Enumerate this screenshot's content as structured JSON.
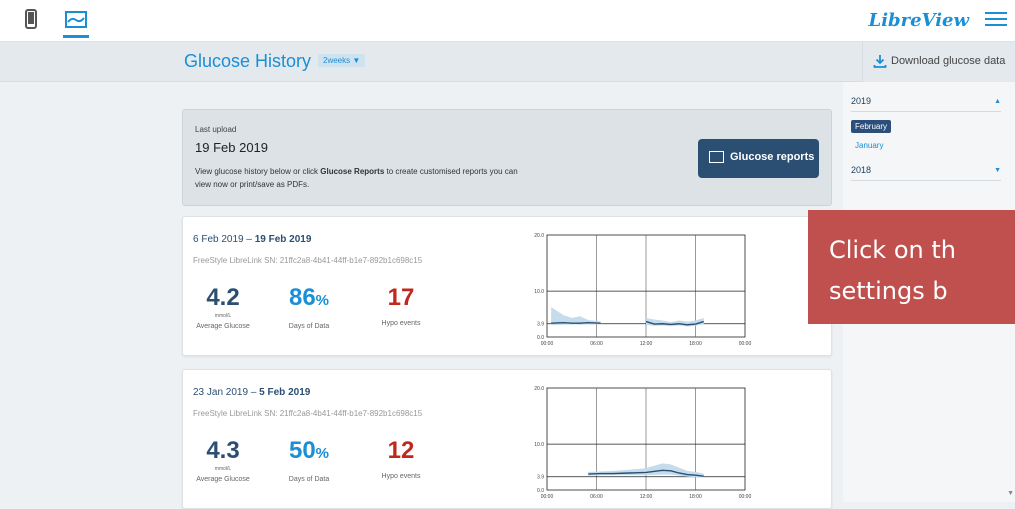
{
  "brand": {
    "name": "LibreView"
  },
  "header": {
    "title": "Glucose History",
    "range": "2weeks",
    "download": "Download glucose data"
  },
  "sidebar": {
    "years": [
      {
        "label": "2019",
        "expanded": true,
        "months": [
          {
            "label": "February",
            "selected": true
          },
          {
            "label": "January",
            "selected": false
          }
        ]
      },
      {
        "label": "2018",
        "expanded": false,
        "months": []
      }
    ]
  },
  "upload": {
    "label": "Last upload",
    "date": "19 Feb 2019",
    "text_before": "View glucose history below or click ",
    "text_bold": "Glucose Reports",
    "text_after": " to create customised reports you can view now or print/save as PDFs.",
    "button": "Glucose reports"
  },
  "cards": [
    {
      "range_start": "6 Feb 2019 – ",
      "range_end": "19 Feb 2019",
      "device": "FreeStyle LibreLink  SN: 21ffc2a8-4b41-44ff-b1e7-892b1c698c15",
      "avg_glucose": "4.2",
      "avg_unit": "mmol/L",
      "avg_label": "Average Glucose",
      "days": "86",
      "days_pct": "%",
      "days_label": "Days of Data",
      "hypo": "17",
      "hypo_label": "Hypo events"
    },
    {
      "range_start": "23 Jan 2019 – ",
      "range_end": "5 Feb 2019",
      "device": "FreeStyle LibreLink  SN: 21ffc2a8-4b41-44ff-b1e7-892b1c698c15",
      "avg_glucose": "4.3",
      "avg_unit": "mmol/L",
      "avg_label": "Average Glucose",
      "days": "50",
      "days_pct": "%",
      "days_label": "Days of Data",
      "hypo": "12",
      "hypo_label": "Hypo events"
    }
  ],
  "chart_data": [
    {
      "type": "line",
      "y_ticks": [
        "20.0",
        "10.0",
        "3.9",
        "0.0"
      ],
      "x_ticks": [
        "00:00",
        "06:00",
        "12:00",
        "18:00",
        "00:00"
      ],
      "ylim": [
        0,
        20
      ],
      "x_hours": [
        0.5,
        2,
        3,
        4,
        5,
        6.5,
        11,
        12,
        13,
        14,
        15,
        16,
        17,
        18,
        19
      ],
      "median": [
        4.0,
        4.1,
        4.0,
        4.0,
        4.1,
        4.0,
        null,
        4.3,
        3.8,
        3.9,
        3.7,
        3.9,
        3.6,
        3.8,
        4.3
      ],
      "band_high": [
        7.0,
        5.5,
        5.0,
        5.3,
        4.6,
        4.3,
        null,
        5.0,
        4.7,
        4.5,
        4.2,
        4.5,
        4.3,
        4.5,
        5.0
      ],
      "band_low": [
        3.5,
        3.6,
        3.7,
        3.6,
        3.7,
        3.7,
        null,
        3.6,
        3.3,
        3.4,
        3.2,
        3.4,
        3.1,
        3.3,
        3.7
      ]
    },
    {
      "type": "line",
      "y_ticks": [
        "20.0",
        "10.0",
        "3.9",
        "0.0"
      ],
      "x_ticks": [
        "00:00",
        "06:00",
        "12:00",
        "18:00",
        "00:00"
      ],
      "ylim": [
        0,
        20
      ],
      "x_hours": [
        5,
        6.5,
        8,
        10,
        12,
        14,
        15,
        16,
        17,
        18,
        19
      ],
      "median": [
        4.4,
        4.5,
        4.5,
        4.6,
        4.7,
        5.1,
        5.0,
        4.6,
        4.3,
        4.2,
        4.0
      ],
      "band_high": [
        4.8,
        4.9,
        5.0,
        5.2,
        5.5,
        6.4,
        6.2,
        5.6,
        5.0,
        4.8,
        4.5
      ],
      "band_low": [
        4.1,
        4.2,
        4.2,
        4.2,
        4.2,
        4.3,
        4.3,
        4.1,
        3.9,
        3.8,
        3.7
      ]
    }
  ],
  "overlay": {
    "line1": "Click on th",
    "line2": "settings b"
  }
}
